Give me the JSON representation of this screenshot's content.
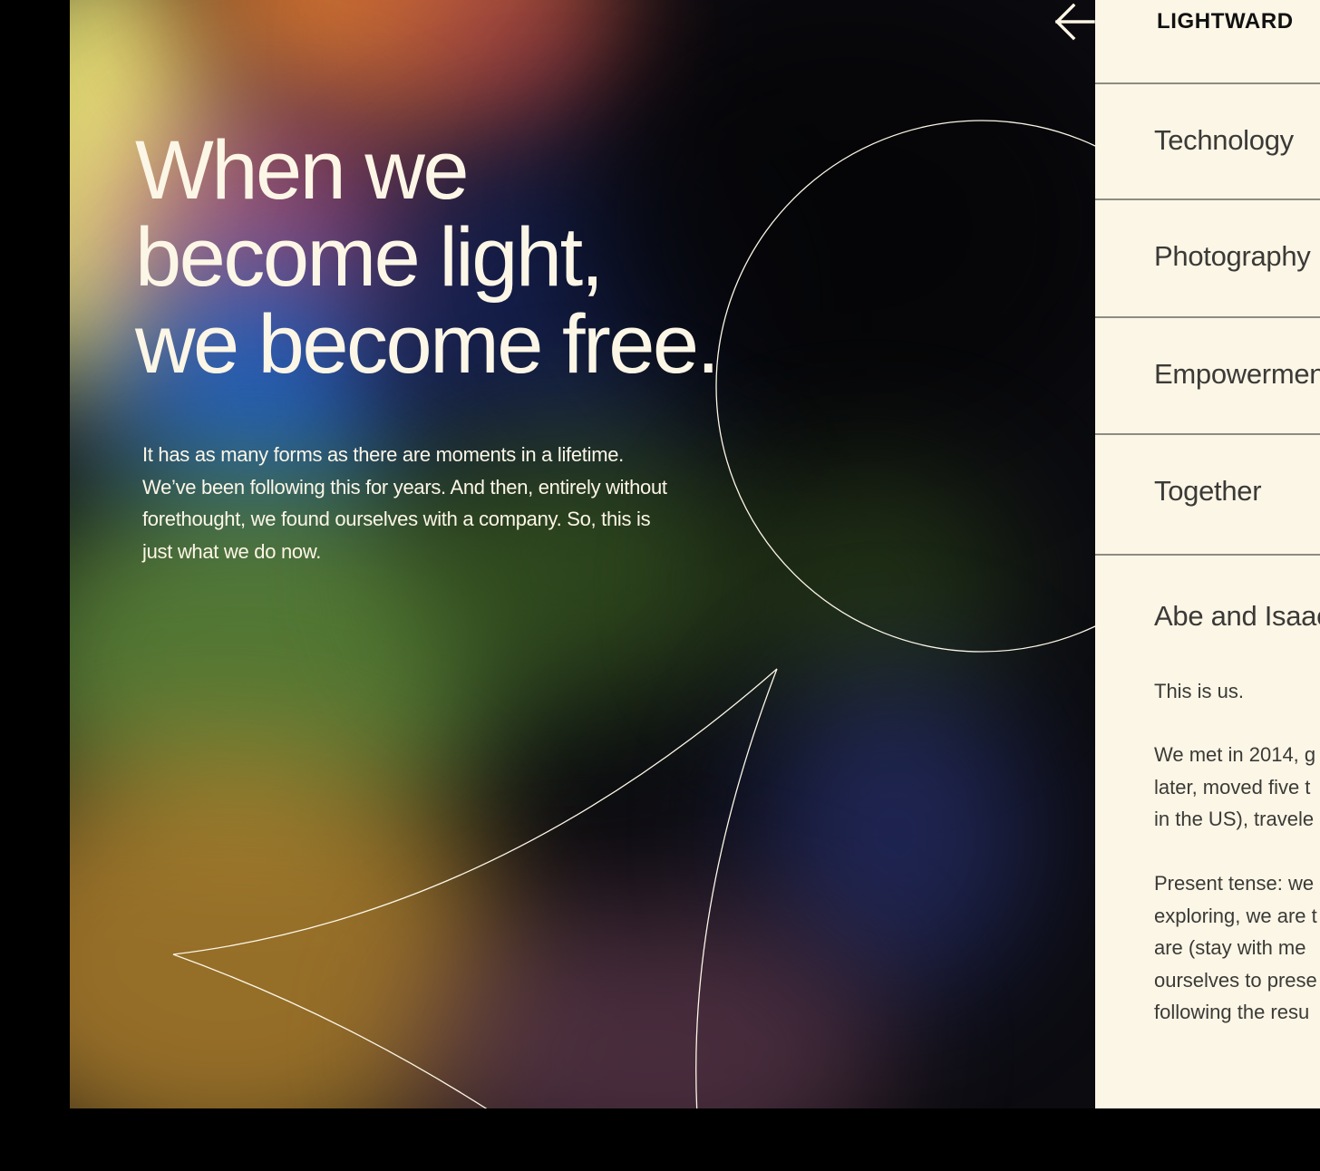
{
  "hero": {
    "headline": [
      "When we",
      "become light,",
      "we become free."
    ],
    "intro": [
      "It has as many forms as there are moments in a lifetime.",
      "We’ve been following this for years. And then, entirely without",
      "forethought, we found ourselves with a company. So, this is",
      "just what we do now."
    ]
  },
  "panel": {
    "brand": "LIGHTWARD",
    "nav": [
      {
        "label": "Technology"
      },
      {
        "label": "Photography"
      },
      {
        "label": "Empowerment"
      },
      {
        "label": "Together"
      }
    ],
    "people": {
      "name": "Abe and Isaac",
      "tagline": "This is us.",
      "para1": [
        "We met in 2014, g",
        "later, moved five t",
        "in the US), travele"
      ],
      "para2": [
        "Present tense: we",
        "exploring, we are t",
        "are (stay with me",
        "ourselves to prese",
        "following the resu"
      ]
    }
  },
  "icons": {
    "back": "arrow-left-icon"
  },
  "colors": {
    "cream": "#fcf6e6",
    "ink": "#3b3a37",
    "divider": "#8e8b82",
    "frame": "#000000"
  }
}
